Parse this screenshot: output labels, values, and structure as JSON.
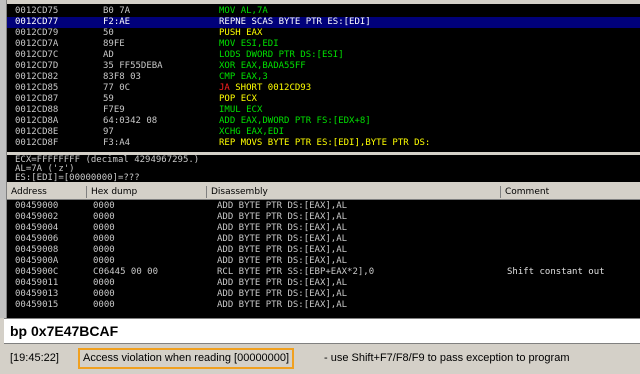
{
  "disasm_rows": [
    {
      "addr": "0012CD75",
      "hex": "B0 7A",
      "mnemonic": "MOV",
      "operands": "AL,7A",
      "color": "#00e000",
      "selected": false
    },
    {
      "addr": "0012CD77",
      "hex": "F2:AE",
      "mnemonic": "REPNE SCAS",
      "operands": "BYTE PTR ES:[EDI]",
      "color": "#ffffff",
      "selected": true
    },
    {
      "addr": "0012CD79",
      "hex": "50",
      "mnemonic": "PUSH",
      "operands": "EAX",
      "color": "#ffff00",
      "selected": false
    },
    {
      "addr": "0012CD7A",
      "hex": "89FE",
      "mnemonic": "MOV",
      "operands": "ESI,EDI",
      "color": "#00e000",
      "selected": false
    },
    {
      "addr": "0012CD7C",
      "hex": "AD",
      "mnemonic": "LODS",
      "operands": "DWORD PTR DS:[ESI]",
      "color": "#00e000",
      "selected": false
    },
    {
      "addr": "0012CD7D",
      "hex": "35 FF55DEBA",
      "mnemonic": "XOR",
      "operands": "EAX,BADA55FF",
      "color": "#00e000",
      "selected": false
    },
    {
      "addr": "0012CD82",
      "hex": "83F8 03",
      "mnemonic": "CMP",
      "operands": "EAX,3",
      "color": "#00e000",
      "selected": false
    },
    {
      "addr": "0012CD85",
      "hex": "77 0C",
      "mnemonic": "JA",
      "operands": "SHORT 0012CD93",
      "color": "#ffff00",
      "selected": false,
      "jump": true
    },
    {
      "addr": "0012CD87",
      "hex": "59",
      "mnemonic": "POP",
      "operands": "ECX",
      "color": "#ffff00",
      "selected": false
    },
    {
      "addr": "0012CD88",
      "hex": "F7E9",
      "mnemonic": "IMUL",
      "operands": "ECX",
      "color": "#00e000",
      "selected": false
    },
    {
      "addr": "0012CD8A",
      "hex": "64:0342 08",
      "mnemonic": "ADD",
      "operands": "EAX,DWORD PTR FS:[EDX+8]",
      "color": "#00e000",
      "selected": false
    },
    {
      "addr": "0012CD8E",
      "hex": "97",
      "mnemonic": "XCHG",
      "operands": "EAX,EDI",
      "color": "#00e000",
      "selected": false
    },
    {
      "addr": "0012CD8F",
      "hex": "F3:A4",
      "mnemonic": "REP MOVS",
      "operands": "BYTE PTR ES:[EDI],BYTE PTR DS:",
      "color": "#ffff00",
      "selected": false
    }
  ],
  "info_lines": [
    "ECX=FFFFFFFF (decimal 4294967295.)",
    "AL=7A ('z')",
    "ES:[EDI]=[00000000]=???"
  ],
  "dump_header": {
    "address": "Address",
    "hex": "Hex dump",
    "disasm": "Disassembly",
    "comment": "Comment"
  },
  "dump_rows": [
    {
      "addr": "00459000",
      "hex": "0000",
      "dis": "ADD BYTE PTR DS:[EAX],AL",
      "comment": ""
    },
    {
      "addr": "00459002",
      "hex": "0000",
      "dis": "ADD BYTE PTR DS:[EAX],AL",
      "comment": ""
    },
    {
      "addr": "00459004",
      "hex": "0000",
      "dis": "ADD BYTE PTR DS:[EAX],AL",
      "comment": ""
    },
    {
      "addr": "00459006",
      "hex": "0000",
      "dis": "ADD BYTE PTR DS:[EAX],AL",
      "comment": ""
    },
    {
      "addr": "00459008",
      "hex": "0000",
      "dis": "ADD BYTE PTR DS:[EAX],AL",
      "comment": ""
    },
    {
      "addr": "0045900A",
      "hex": "0000",
      "dis": "ADD BYTE PTR DS:[EAX],AL",
      "comment": ""
    },
    {
      "addr": "0045900C",
      "hex": "C06445 00 00",
      "dis": "RCL BYTE PTR SS:[EBP+EAX*2],0",
      "comment": "Shift constant out"
    },
    {
      "addr": "00459011",
      "hex": "0000",
      "dis": "ADD BYTE PTR DS:[EAX],AL",
      "comment": ""
    },
    {
      "addr": "00459013",
      "hex": "0000",
      "dis": "ADD BYTE PTR DS:[EAX],AL",
      "comment": ""
    },
    {
      "addr": "00459015",
      "hex": "0000",
      "dis": "ADD BYTE PTR DS:[EAX],AL",
      "comment": ""
    }
  ],
  "command": {
    "value": "bp 0x7E47BCAF"
  },
  "status": {
    "time": "[19:45:22]",
    "message": "Access violation when reading [00000000]",
    "rest": "- use Shift+F7/F8/F9 to pass exception to program",
    "accent": "#f0a020"
  }
}
